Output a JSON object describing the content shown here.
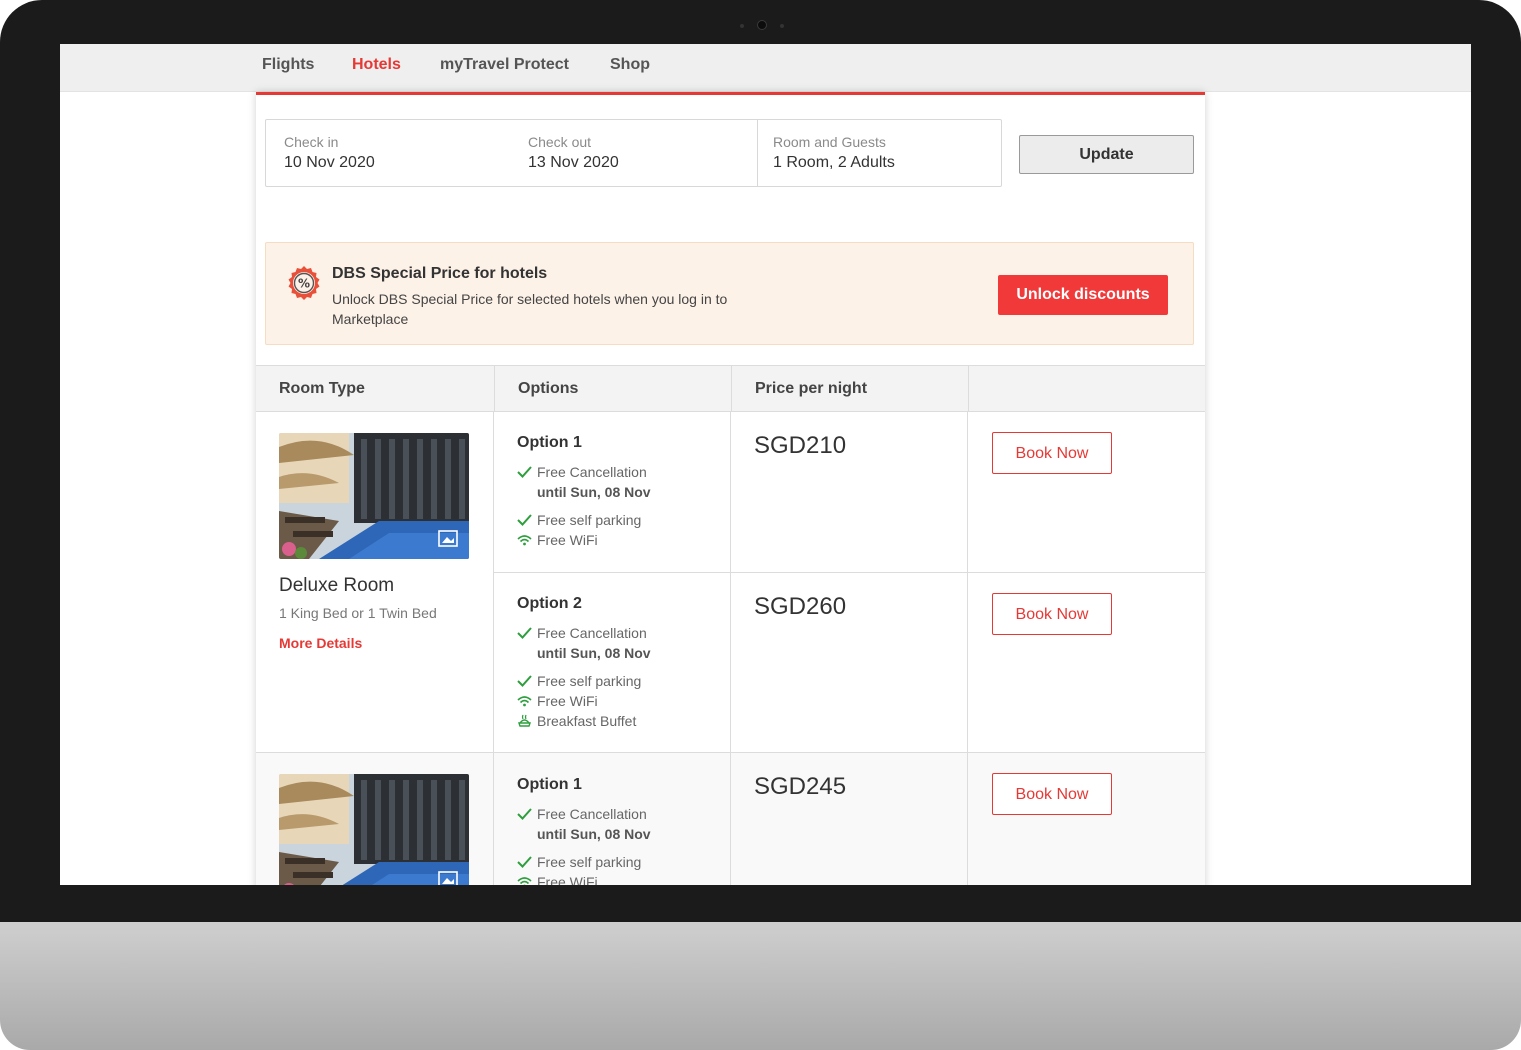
{
  "nav": {
    "items": [
      {
        "label": "Flights",
        "active": false
      },
      {
        "label": "Hotels",
        "active": true
      },
      {
        "label": "myTravel Protect",
        "active": false
      },
      {
        "label": "Shop",
        "active": false
      }
    ]
  },
  "search": {
    "check_in": {
      "label": "Check in",
      "value": "10 Nov 2020"
    },
    "check_out": {
      "label": "Check out",
      "value": "13 Nov 2020"
    },
    "room_guests": {
      "label": "Room and Guests",
      "value": "1 Room, 2 Adults"
    },
    "update_label": "Update"
  },
  "promo": {
    "title": "DBS Special Price for hotels",
    "text": "Unlock DBS Special Price for selected hotels when you log in to Marketplace",
    "button_label": "Unlock discounts",
    "icon": "percent-badge-icon"
  },
  "table": {
    "headers": [
      "Room Type",
      "Options",
      "Price per night",
      ""
    ]
  },
  "rooms": [
    {
      "name": "Deluxe Room",
      "beds": "1 King Bed or 1 Twin Bed",
      "more_details": "More Details",
      "options": [
        {
          "title": "Option 1",
          "cancellation": "Free Cancellation",
          "cancellation_until": "until Sun, 08 Nov",
          "features": [
            "Free self parking",
            "Free WiFi"
          ],
          "price": "SGD210",
          "book_label": "Book Now"
        },
        {
          "title": "Option 2",
          "cancellation": "Free Cancellation",
          "cancellation_until": "until Sun, 08 Nov",
          "features": [
            "Free self parking",
            "Free WiFi",
            "Breakfast Buffet"
          ],
          "price": "SGD260",
          "book_label": "Book Now"
        }
      ]
    },
    {
      "options": [
        {
          "title": "Option 1",
          "cancellation": "Free Cancellation",
          "cancellation_until": "until Sun, 08 Nov",
          "features": [
            "Free self parking",
            "Free WiFi"
          ],
          "price": "SGD245",
          "book_label": "Book Now"
        }
      ]
    }
  ],
  "colors": {
    "accent": "#e53935",
    "promo_bg": "#fdf2e8",
    "check": "#2e9e3e"
  }
}
